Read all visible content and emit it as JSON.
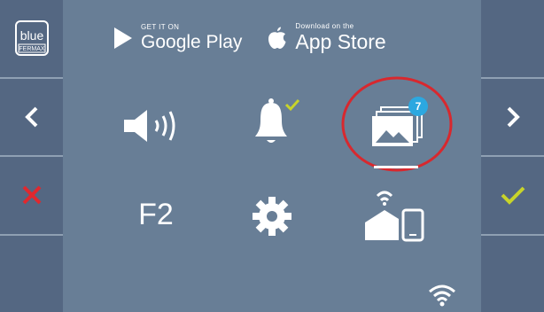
{
  "brand": {
    "logo_top": "blue",
    "logo_bottom": "FERMAX"
  },
  "stores": {
    "google": {
      "small": "GET IT ON",
      "big": "Google Play"
    },
    "apple": {
      "small": "Download on the",
      "big": "App Store"
    }
  },
  "tiles": {
    "f2_label": "F2",
    "gallery_badge": "7"
  },
  "colors": {
    "accent_check": "#c8d42a",
    "accent_cross": "#e0282e",
    "highlight_ring": "#d8282e",
    "badge": "#2ca8e0"
  },
  "icons": [
    "speaker-icon",
    "bell-icon",
    "gallery-icon",
    "settings-icon",
    "home-mobile-icon",
    "wifi-icon"
  ]
}
